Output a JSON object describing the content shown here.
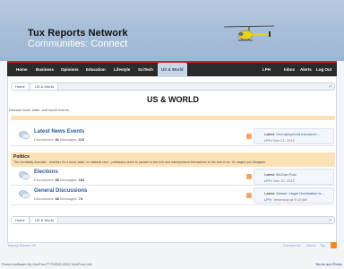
{
  "header": {
    "title": "Tux Reports Network",
    "subtitle": "Communities: Connect"
  },
  "nav": {
    "items": [
      "Home",
      "Business",
      "Opinions",
      "Education",
      "Lifestyle",
      "SciTech",
      "US & World"
    ],
    "active": "US & World",
    "right": [
      "LPH",
      "Inbox",
      "Alerts",
      "Log Out"
    ]
  },
  "breadcrumb": [
    "Home",
    "US & World"
  ],
  "page": {
    "title": "US & WORLD",
    "description": "Discuss local, state, and world events"
  },
  "forums": [
    {
      "name": "Latest News Events",
      "discussions_label": "Discussions:",
      "discussions": "81",
      "messages_label": "Messages:",
      "messages": "110",
      "latest_label": "Latest:",
      "latest_title": "Unemployment Insurance...",
      "latest_user": "LPH",
      "latest_date": "Dec 21, 2012"
    },
    {
      "name": "Elections",
      "discussions_label": "Discussions:",
      "discussions": "85",
      "messages_label": "Messages:",
      "messages": "183",
      "latest_label": "Latest:",
      "latest_title": "McCain Pals",
      "latest_user": "LPH",
      "latest_date": "Nov 10, 2012"
    },
    {
      "name": "General Discussions",
      "discussions_label": "Discussions:",
      "discussions": "68",
      "messages_label": "Messages:",
      "messages": "74",
      "latest_label": "Latest:",
      "latest_title": "Weiser: Hagel Nomination is...",
      "latest_user": "LPH",
      "latest_date": "Yesterday at 9:10 AM"
    }
  ],
  "category": {
    "name": "Politics",
    "description": "The inevitably dramatic - whether it's a local, state, or national race - politicians seem to pander to the rich and misrepresent themselves to the rest of us. Or maybe you disagree."
  },
  "footer": {
    "style": "Twenty Eleven XF",
    "links": [
      "Contact Us",
      "Home",
      "Top"
    ],
    "copyright": "Forum software by XenForo™ ©2010-2012 XenForo Ltd.",
    "terms": "Terms and Rules"
  },
  "colors": {
    "nav_accent": "#c5222b",
    "link": "#2d5a9a",
    "category_bg": "#fbe1b6"
  }
}
